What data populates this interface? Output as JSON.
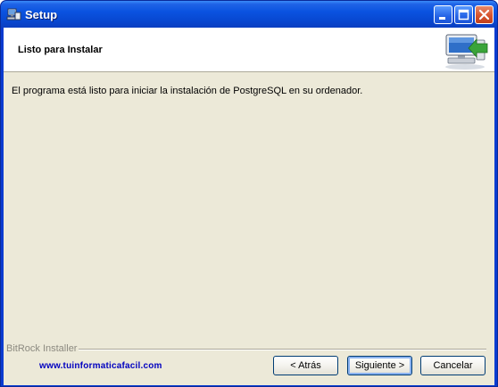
{
  "window": {
    "title": "Setup"
  },
  "header": {
    "title": "Listo para Instalar"
  },
  "body": {
    "message": "El programa está listo para iniciar la instalación de PostgreSQL en su ordenador."
  },
  "footer": {
    "installer_label": "BitRock Installer",
    "website": "www.tuinformaticafacil.com"
  },
  "buttons": {
    "back": "< Atrás",
    "next": "Siguiente >",
    "cancel": "Cancelar"
  },
  "icons": {
    "title": "setup-app-icon",
    "header": "computer-install-icon",
    "minimize": "minimize-icon",
    "maximize": "maximize-icon",
    "close": "close-icon"
  },
  "colors": {
    "titlebar": "#0a53e0",
    "dialog_background": "#ece9d8",
    "link": "#0000c0",
    "close_button": "#d7542e"
  }
}
